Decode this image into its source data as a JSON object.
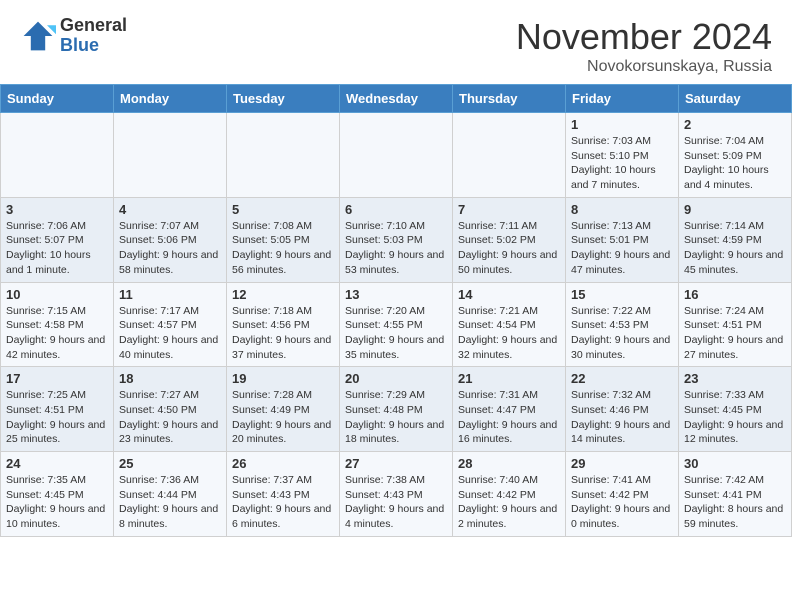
{
  "header": {
    "logo_general": "General",
    "logo_blue": "Blue",
    "month_title": "November 2024",
    "location": "Novokorsunskaya, Russia"
  },
  "days_of_week": [
    "Sunday",
    "Monday",
    "Tuesday",
    "Wednesday",
    "Thursday",
    "Friday",
    "Saturday"
  ],
  "weeks": [
    [
      {
        "day": "",
        "info": ""
      },
      {
        "day": "",
        "info": ""
      },
      {
        "day": "",
        "info": ""
      },
      {
        "day": "",
        "info": ""
      },
      {
        "day": "",
        "info": ""
      },
      {
        "day": "1",
        "info": "Sunrise: 7:03 AM\nSunset: 5:10 PM\nDaylight: 10 hours and 7 minutes."
      },
      {
        "day": "2",
        "info": "Sunrise: 7:04 AM\nSunset: 5:09 PM\nDaylight: 10 hours and 4 minutes."
      }
    ],
    [
      {
        "day": "3",
        "info": "Sunrise: 7:06 AM\nSunset: 5:07 PM\nDaylight: 10 hours and 1 minute."
      },
      {
        "day": "4",
        "info": "Sunrise: 7:07 AM\nSunset: 5:06 PM\nDaylight: 9 hours and 58 minutes."
      },
      {
        "day": "5",
        "info": "Sunrise: 7:08 AM\nSunset: 5:05 PM\nDaylight: 9 hours and 56 minutes."
      },
      {
        "day": "6",
        "info": "Sunrise: 7:10 AM\nSunset: 5:03 PM\nDaylight: 9 hours and 53 minutes."
      },
      {
        "day": "7",
        "info": "Sunrise: 7:11 AM\nSunset: 5:02 PM\nDaylight: 9 hours and 50 minutes."
      },
      {
        "day": "8",
        "info": "Sunrise: 7:13 AM\nSunset: 5:01 PM\nDaylight: 9 hours and 47 minutes."
      },
      {
        "day": "9",
        "info": "Sunrise: 7:14 AM\nSunset: 4:59 PM\nDaylight: 9 hours and 45 minutes."
      }
    ],
    [
      {
        "day": "10",
        "info": "Sunrise: 7:15 AM\nSunset: 4:58 PM\nDaylight: 9 hours and 42 minutes."
      },
      {
        "day": "11",
        "info": "Sunrise: 7:17 AM\nSunset: 4:57 PM\nDaylight: 9 hours and 40 minutes."
      },
      {
        "day": "12",
        "info": "Sunrise: 7:18 AM\nSunset: 4:56 PM\nDaylight: 9 hours and 37 minutes."
      },
      {
        "day": "13",
        "info": "Sunrise: 7:20 AM\nSunset: 4:55 PM\nDaylight: 9 hours and 35 minutes."
      },
      {
        "day": "14",
        "info": "Sunrise: 7:21 AM\nSunset: 4:54 PM\nDaylight: 9 hours and 32 minutes."
      },
      {
        "day": "15",
        "info": "Sunrise: 7:22 AM\nSunset: 4:53 PM\nDaylight: 9 hours and 30 minutes."
      },
      {
        "day": "16",
        "info": "Sunrise: 7:24 AM\nSunset: 4:51 PM\nDaylight: 9 hours and 27 minutes."
      }
    ],
    [
      {
        "day": "17",
        "info": "Sunrise: 7:25 AM\nSunset: 4:51 PM\nDaylight: 9 hours and 25 minutes."
      },
      {
        "day": "18",
        "info": "Sunrise: 7:27 AM\nSunset: 4:50 PM\nDaylight: 9 hours and 23 minutes."
      },
      {
        "day": "19",
        "info": "Sunrise: 7:28 AM\nSunset: 4:49 PM\nDaylight: 9 hours and 20 minutes."
      },
      {
        "day": "20",
        "info": "Sunrise: 7:29 AM\nSunset: 4:48 PM\nDaylight: 9 hours and 18 minutes."
      },
      {
        "day": "21",
        "info": "Sunrise: 7:31 AM\nSunset: 4:47 PM\nDaylight: 9 hours and 16 minutes."
      },
      {
        "day": "22",
        "info": "Sunrise: 7:32 AM\nSunset: 4:46 PM\nDaylight: 9 hours and 14 minutes."
      },
      {
        "day": "23",
        "info": "Sunrise: 7:33 AM\nSunset: 4:45 PM\nDaylight: 9 hours and 12 minutes."
      }
    ],
    [
      {
        "day": "24",
        "info": "Sunrise: 7:35 AM\nSunset: 4:45 PM\nDaylight: 9 hours and 10 minutes."
      },
      {
        "day": "25",
        "info": "Sunrise: 7:36 AM\nSunset: 4:44 PM\nDaylight: 9 hours and 8 minutes."
      },
      {
        "day": "26",
        "info": "Sunrise: 7:37 AM\nSunset: 4:43 PM\nDaylight: 9 hours and 6 minutes."
      },
      {
        "day": "27",
        "info": "Sunrise: 7:38 AM\nSunset: 4:43 PM\nDaylight: 9 hours and 4 minutes."
      },
      {
        "day": "28",
        "info": "Sunrise: 7:40 AM\nSunset: 4:42 PM\nDaylight: 9 hours and 2 minutes."
      },
      {
        "day": "29",
        "info": "Sunrise: 7:41 AM\nSunset: 4:42 PM\nDaylight: 9 hours and 0 minutes."
      },
      {
        "day": "30",
        "info": "Sunrise: 7:42 AM\nSunset: 4:41 PM\nDaylight: 8 hours and 59 minutes."
      }
    ]
  ]
}
